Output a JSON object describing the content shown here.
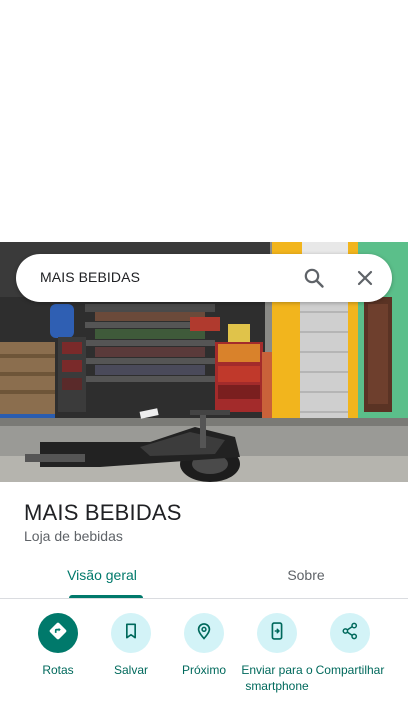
{
  "search": {
    "query": "MAIS BEBIDAS"
  },
  "place": {
    "title": "MAIS BEBIDAS",
    "category": "Loja de bebidas"
  },
  "tabs": [
    {
      "label": "Visão geral",
      "active": true
    },
    {
      "label": "Sobre",
      "active": false
    }
  ],
  "actions": [
    {
      "label": "Rotas",
      "icon": "directions-icon",
      "primary": true
    },
    {
      "label": "Salvar",
      "icon": "bookmark-icon",
      "primary": false
    },
    {
      "label": "Próximo",
      "icon": "nearby-icon",
      "primary": false
    },
    {
      "label": "Enviar para o smartphone",
      "icon": "send-to-phone-icon",
      "primary": false
    },
    {
      "label": "Compartilhar",
      "icon": "share-icon",
      "primary": false
    }
  ],
  "colors": {
    "accent": "#00796b",
    "action_bg": "#d3f3f7",
    "action_text": "#00695c",
    "muted_text": "#5f6368"
  }
}
